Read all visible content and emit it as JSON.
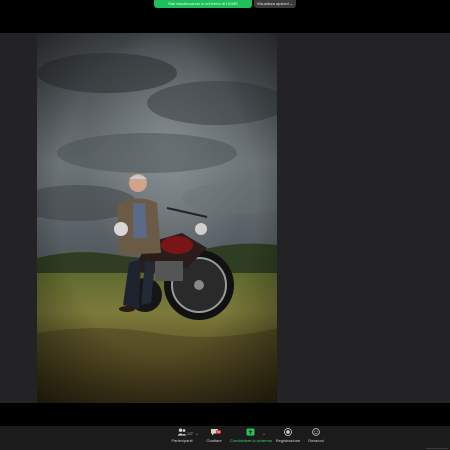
{
  "top": {
    "share_banner": "Stai visualizzando lo schermo di HOME",
    "view_options": "Visualizza opzioni",
    "view_options_chevron": "⌄"
  },
  "toolbar": {
    "participants_label": "Partecipanti",
    "participants_count": "127",
    "chat_label": "Chattare",
    "chat_badge": "99",
    "share_label": "Condividere lo schermo",
    "record_label": "Registrazione",
    "reactions_label": "Reazioni",
    "chevron": "^"
  },
  "icons": {
    "participants": "people-icon",
    "chat": "chat-bubble-icon",
    "share": "share-screen-icon",
    "record": "record-icon",
    "reactions": "smiley-icon"
  },
  "colors": {
    "share_green": "#1fbf5b",
    "badge_red": "#e02828",
    "toolbar_bg": "#1b1b1c"
  }
}
